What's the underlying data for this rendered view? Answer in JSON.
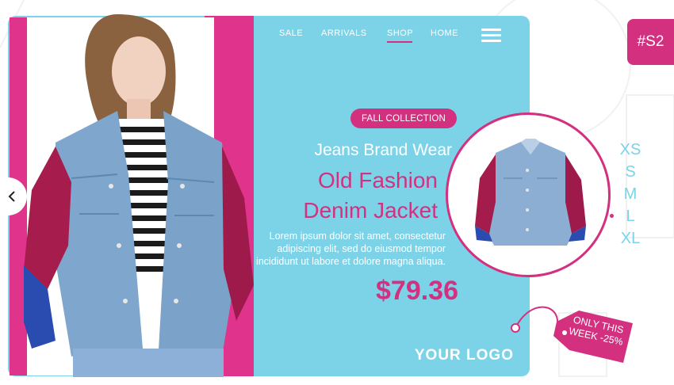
{
  "nav": {
    "items": [
      {
        "label": "SALE"
      },
      {
        "label": "ARRIVALS"
      },
      {
        "label": "SHOP"
      },
      {
        "label": "HOME"
      }
    ],
    "active": "SHOP"
  },
  "product": {
    "collection_label": "FALL COLLECTION",
    "brand": "Jeans Brand Wear",
    "title_line1": "Old Fashion",
    "title_line2": "Denim Jacket",
    "description": "Lorem ipsum dolor sit amet, consectetur adipiscing elit, sed do eiusmod tempor incididunt ut labore et dolore magna aliqua.",
    "price": "$79.36"
  },
  "sizes": [
    "XS",
    "S",
    "M",
    "L",
    "XL"
  ],
  "selected_size": "L",
  "logo_text": "YOUR LOGO",
  "corner_badge": "#S2",
  "promo_tag": {
    "line1": "ONLY THIS",
    "line2": "WEEK -25%"
  },
  "colors": {
    "accent": "#d3307f",
    "panel": "#7cd3e8",
    "white": "#ffffff"
  },
  "icons": [
    "chevron-left-icon",
    "hamburger-menu-icon",
    "price-tag-icon"
  ]
}
